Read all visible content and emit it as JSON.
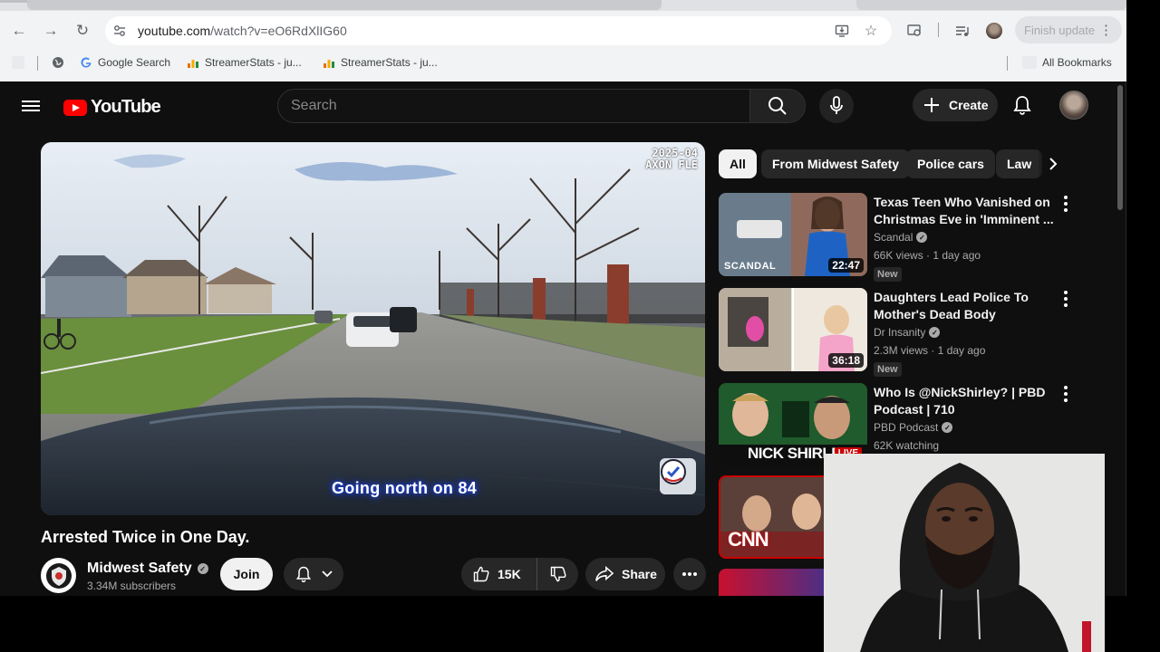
{
  "browser": {
    "url_host": "youtube.com",
    "url_path": "/watch?v=eO6RdXlIG60",
    "finish_update_label": "Finish update",
    "bookmarks": [
      {
        "label": "Google Search"
      },
      {
        "label": "StreamerStats - ju..."
      },
      {
        "label": "StreamerStats - ju..."
      }
    ],
    "all_bookmarks_label": "All Bookmarks"
  },
  "youtube": {
    "logo_text": "YouTube",
    "search_placeholder": "Search",
    "create_label": "Create",
    "video": {
      "timestamp_line1": "2025-04",
      "timestamp_line2": "AXON FLE",
      "caption": "Going north on 84",
      "title": "Arrested Twice in One Day."
    },
    "channel": {
      "name": "Midwest Safety",
      "subscribers": "3.34M subscribers",
      "join_label": "Join"
    },
    "actions": {
      "likes": "15K",
      "share_label": "Share"
    },
    "chips": [
      "All",
      "From Midwest Safety",
      "Police cars",
      "Law"
    ],
    "recommendations": [
      {
        "title": "Texas Teen Who Vanished on Christmas Eve in 'Imminent ...",
        "channel": "Scandal",
        "meta": "66K views · 1 day ago",
        "badge": "New",
        "duration": "22:47",
        "thumb_text": "SCANDAL"
      },
      {
        "title": "Daughters Lead Police To Mother's Dead Body",
        "channel": "Dr Insanity",
        "meta": "2.3M views · 1 day ago",
        "badge": "New",
        "duration": "36:18"
      },
      {
        "title": "Who Is @NickShirley? | PBD Podcast | 710",
        "channel": "PBD Podcast",
        "meta": "62K watching",
        "thumb_text": "NICK SHIRLEY",
        "live_label": "LIVE"
      },
      {
        "thumb_text": "CNN"
      }
    ]
  },
  "colors": {
    "yt_bg": "#0f0f0f",
    "yt_red": "#ff0000",
    "chip_bg": "#272727",
    "chrome_bg": "#f1f3f4"
  }
}
